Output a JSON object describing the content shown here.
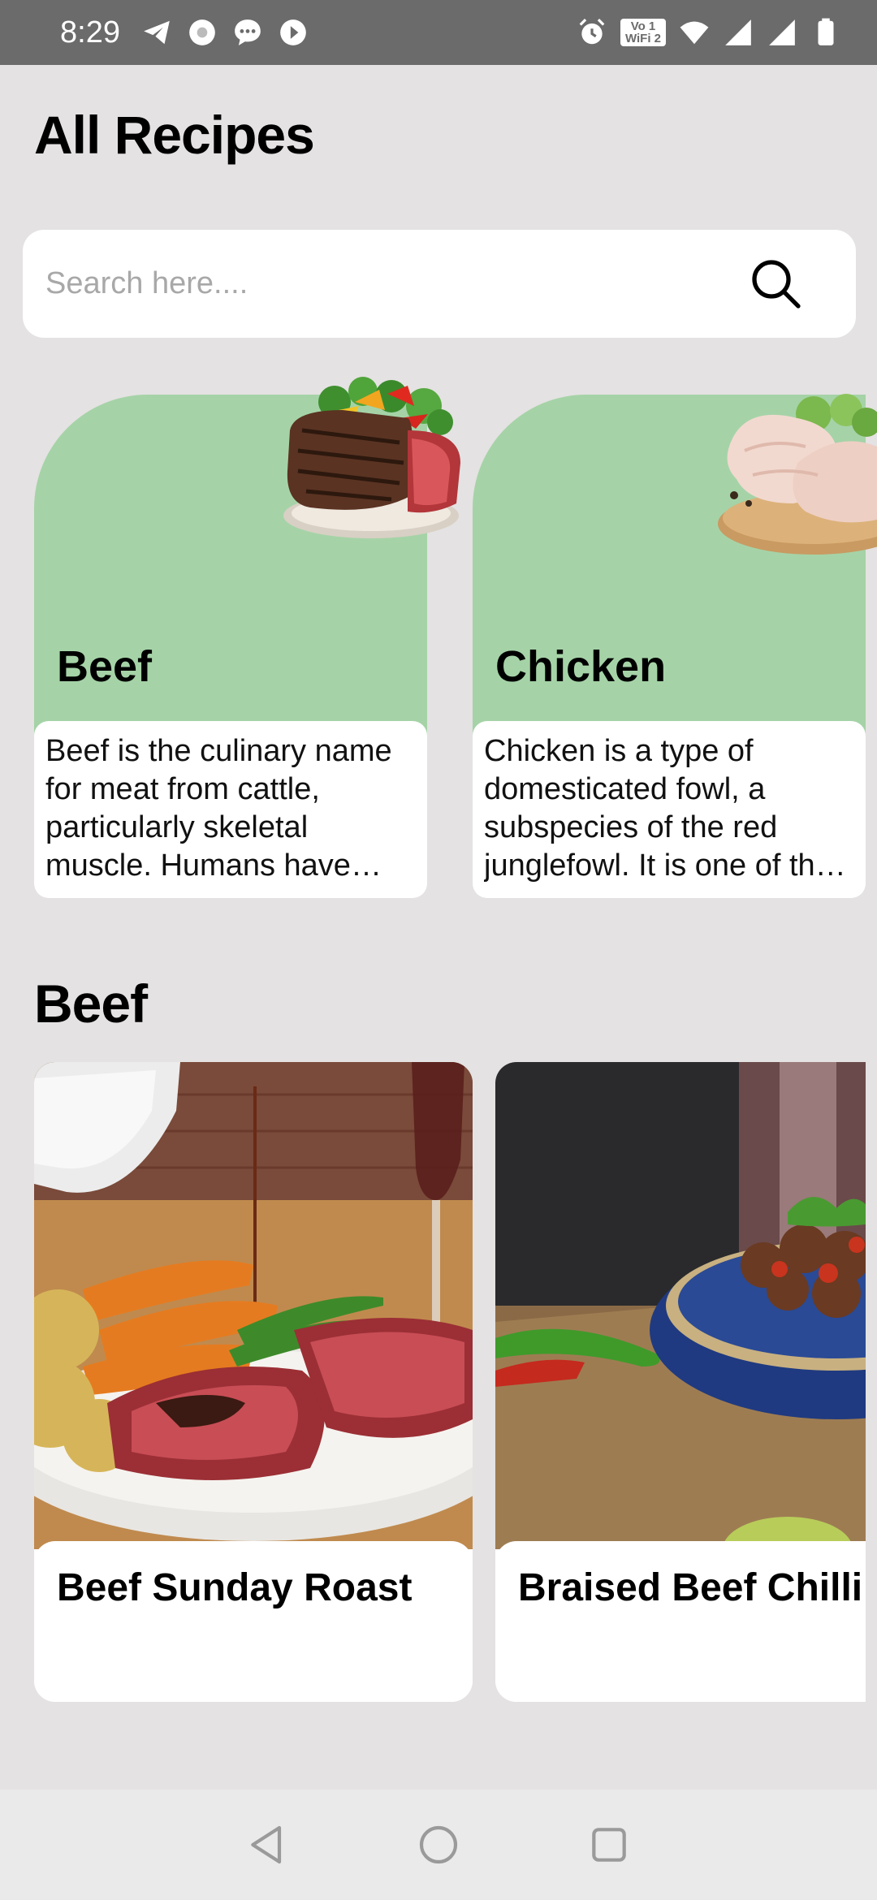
{
  "status_bar": {
    "time": "8:29",
    "left_icons": [
      "telegram-icon",
      "app-badge-icon",
      "messages-icon",
      "play-icon"
    ],
    "right_icons": [
      "alarm-icon",
      "volte-wifi-icon",
      "wifi-icon",
      "signal-icon",
      "signal-icon",
      "battery-icon"
    ],
    "volte_label_1": "Vo 1",
    "volte_label_2": "WiFi 2"
  },
  "header": {
    "title": "All Recipes"
  },
  "search": {
    "placeholder": "Search here....",
    "value": "",
    "icon": "search-icon"
  },
  "categories": [
    {
      "name": "Beef",
      "description": "Beef is the culinary name for meat from cattle, particularly skeletal muscle. Humans have been eating beef since prehistoric times.",
      "image": "steak-image"
    },
    {
      "name": "Chicken",
      "description": "Chicken is a type of domesticated fowl, a subspecies of the red junglefowl. It is one of the most common and widespread domestic animals.",
      "image": "raw-chicken-image"
    }
  ],
  "section": {
    "title": "Beef"
  },
  "recipes": [
    {
      "name": "Beef Sunday Roast",
      "image": "roast-beef-photo"
    },
    {
      "name": "Braised Beef Chilli",
      "image": "beef-chilli-photo"
    }
  ],
  "nav": {
    "buttons": [
      "back-icon",
      "home-icon",
      "recents-icon"
    ]
  },
  "colors": {
    "background": "#e4e2e2",
    "category_green": "#a5d3a7",
    "status_bar": "#6b6b6b"
  }
}
